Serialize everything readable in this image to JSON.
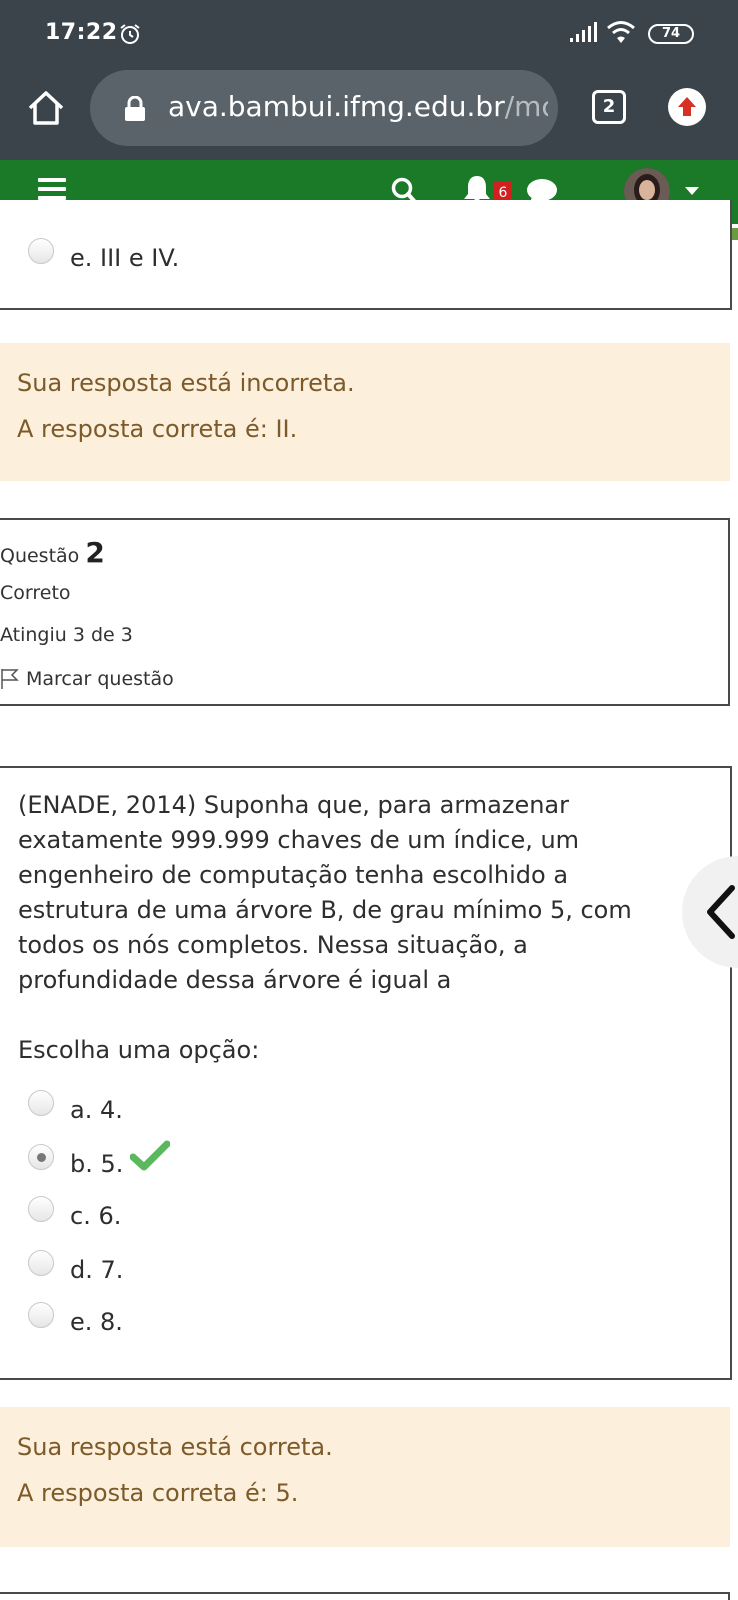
{
  "status_bar": {
    "time": "17:22",
    "battery": "74",
    "icons": [
      "alarm-icon",
      "signal-icon",
      "wifi-icon",
      "battery-icon"
    ]
  },
  "browser": {
    "url_main": "ava.bambui.ifmg.edu.br",
    "url_dim": "/mc",
    "tab_count": "2",
    "icons": [
      "home-icon",
      "lock-icon",
      "tabs-icon",
      "update-icon"
    ]
  },
  "navbar": {
    "notification_count": "6",
    "color": "#1b7a27",
    "icons": [
      "menu-icon",
      "search-icon",
      "bell-icon",
      "chat-icon",
      "avatar",
      "caret-down-icon"
    ]
  },
  "question1": {
    "last_option": "e. III e IV.",
    "feedback_status": "Sua resposta está incorreta.",
    "feedback_answer": "A resposta correta é: II."
  },
  "question2": {
    "label": "Questão",
    "number": "2",
    "state": "Correto",
    "grade": "Atingiu 3 de 3",
    "flag_label": "Marcar questão",
    "text": "(ENADE, 2014)  Suponha que, para armazenar exatamente 999.999 chaves de um índice, um engenheiro de computação tenha escolhido a estrutura de uma árvore B, de grau mínimo 5, com todos os nós completos. Nessa situação, a profundidade dessa árvore é igual a",
    "prompt": "Escolha uma opção:",
    "options": [
      "a. 4.",
      "b. 5.",
      "c. 6.",
      "d. 7.",
      "e. 8."
    ],
    "selected_index": 1,
    "feedback_status": "Sua resposta está correta.",
    "feedback_answer": "A resposta correta é: 5."
  },
  "colors": {
    "feedback_bg": "#fcefdc",
    "feedback_text": "#7d5a29",
    "correct_check": "#5cb85c"
  }
}
